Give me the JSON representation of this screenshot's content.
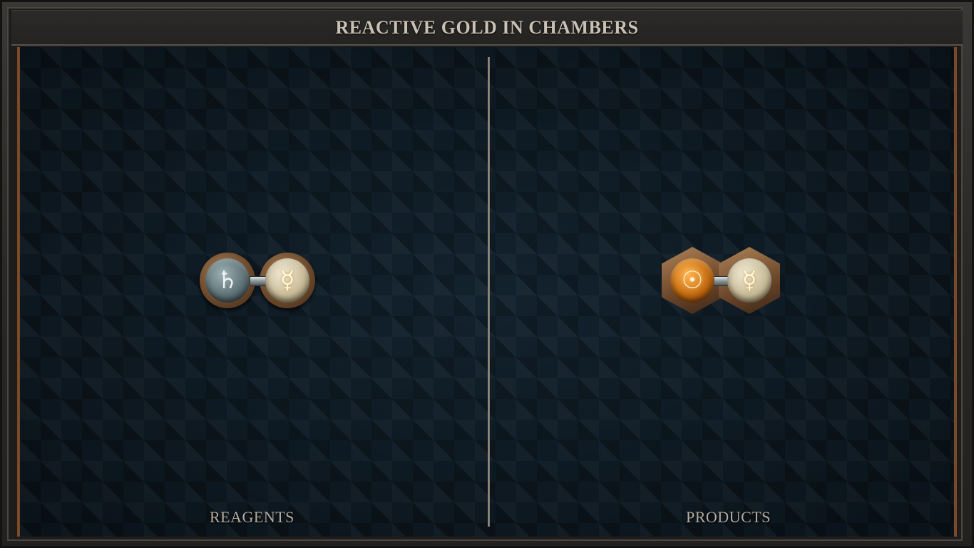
{
  "title": "REACTIVE GOLD IN CHAMBERS",
  "panels": {
    "reagents": {
      "label": "REAGENTS",
      "atoms": [
        {
          "element": "lead",
          "symbol": "♄"
        },
        {
          "element": "quicksilver",
          "symbol": "☿"
        }
      ]
    },
    "products": {
      "label": "PRODUCTS",
      "atoms": [
        {
          "element": "gold",
          "symbol": "☉"
        },
        {
          "element": "quicksilver",
          "symbol": "☿"
        }
      ]
    }
  },
  "colors": {
    "board": "#0f1c26",
    "frame_accent": "#7a4a26",
    "title_text": "#c9c1b4",
    "gold": "#c36a10"
  }
}
